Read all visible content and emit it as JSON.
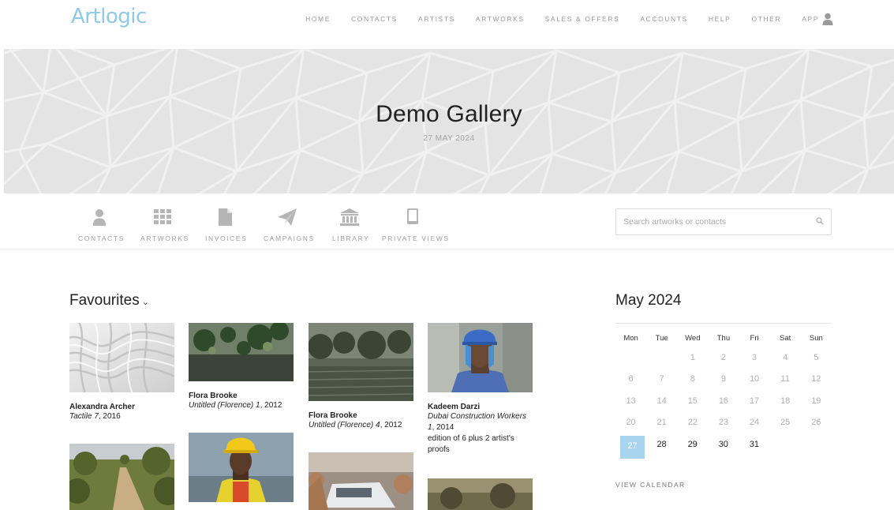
{
  "brand": {
    "logo_text": "Artlogic",
    "accent": "#8ec9e8"
  },
  "nav": {
    "items": [
      "HOME",
      "CONTACTS",
      "ARTISTS",
      "ARTWORKS",
      "SALES & OFFERS",
      "ACCOUNTS",
      "HELP",
      "OTHER",
      "APP"
    ],
    "user_icon": "user-icon"
  },
  "hero": {
    "title": "Demo Gallery",
    "date": "27 MAY 2024"
  },
  "quicknav": {
    "items": [
      {
        "label": "CONTACTS",
        "icon": "person-icon"
      },
      {
        "label": "ARTWORKS",
        "icon": "grid-icon"
      },
      {
        "label": "INVOICES",
        "icon": "document-icon"
      },
      {
        "label": "CAMPAIGNS",
        "icon": "paper-plane-icon"
      },
      {
        "label": "LIBRARY",
        "icon": "library-icon"
      },
      {
        "label": "PRIVATE VIEWS",
        "icon": "tablet-icon"
      }
    ],
    "search_placeholder": "Search artworks or contacts"
  },
  "favourites": {
    "title": "Favourites",
    "cards": [
      {
        "artist": "Alexandra Archer",
        "title": "Tactile 7",
        "year": ", 2016",
        "extra": ""
      },
      {
        "artist": "Flora Brooke",
        "title": "Untitled (Florence) 1",
        "year": ", 2012",
        "extra": ""
      },
      {
        "artist": "Flora Brooke",
        "title": "Untitled (Florence) 4",
        "year": ", 2012",
        "extra": ""
      },
      {
        "artist": "Kadeem Darzi",
        "title": "Dubai Construction Workers 1",
        "year": ", 2014",
        "extra": "edition of 6 plus 2 artist's proofs"
      }
    ]
  },
  "calendar": {
    "title": "May 2024",
    "weekdays": [
      "Mon",
      "Tue",
      "Wed",
      "Thu",
      "Fri",
      "Sat",
      "Sun"
    ],
    "weeks": [
      [
        "",
        "",
        "1",
        "2",
        "3",
        "4",
        "5"
      ],
      [
        "6",
        "7",
        "8",
        "9",
        "10",
        "11",
        "12"
      ],
      [
        "13",
        "14",
        "15",
        "16",
        "17",
        "18",
        "19"
      ],
      [
        "20",
        "21",
        "22",
        "23",
        "24",
        "25",
        "26"
      ],
      [
        "27",
        "28",
        "29",
        "30",
        "31",
        "",
        ""
      ]
    ],
    "today": "27",
    "today_color": "#a9d4ef",
    "view_link": "VIEW CALENDAR"
  }
}
